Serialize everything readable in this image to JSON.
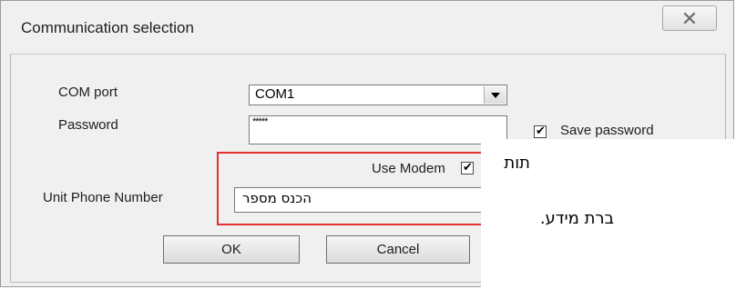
{
  "dialog": {
    "title": "Communication selection",
    "close_icon": "close-icon"
  },
  "form": {
    "com_port_label": "COM port",
    "com_port_value": "COM1",
    "password_label": "Password",
    "password_value": "*****",
    "save_password_label": "Save password",
    "save_password_checked": true,
    "use_modem_label": "Use Modem",
    "use_modem_checked": true,
    "unit_phone_label": "Unit Phone Number",
    "unit_phone_value": "הכנס מספר"
  },
  "buttons": {
    "ok_label": "OK",
    "cancel_label": "Cancel"
  },
  "overlay_text": {
    "line1": "תות",
    "line2": "ברת מידע."
  },
  "colors": {
    "highlight_border": "#e53030",
    "dialog_bg": "#f0f0f0"
  }
}
